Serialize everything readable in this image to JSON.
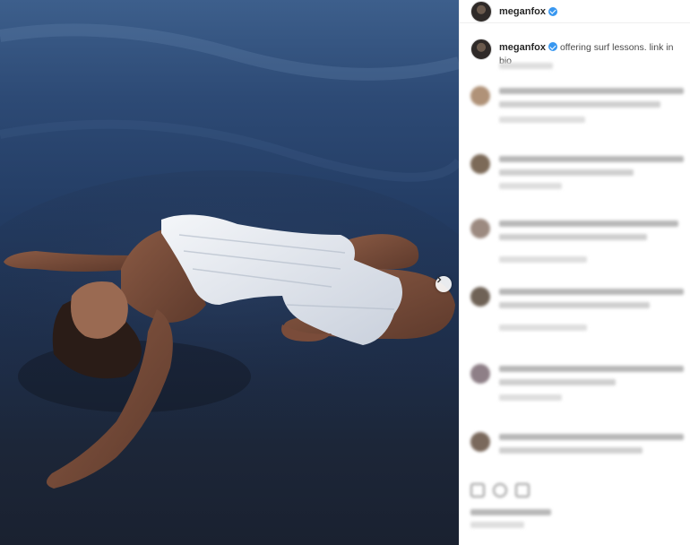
{
  "post": {
    "username": "meganfox",
    "verified": true,
    "caption": "offering surf lessons. link in bio",
    "next_icon": "chevron-right-icon"
  },
  "comments_blurred": true,
  "colors": {
    "verified_badge": "#3897f0",
    "username_text": "#262626",
    "divider": "#efefef"
  },
  "icons": {
    "header_avatar": "avatar-icon",
    "like": "heart-icon",
    "comment": "comment-icon",
    "share": "share-icon"
  }
}
